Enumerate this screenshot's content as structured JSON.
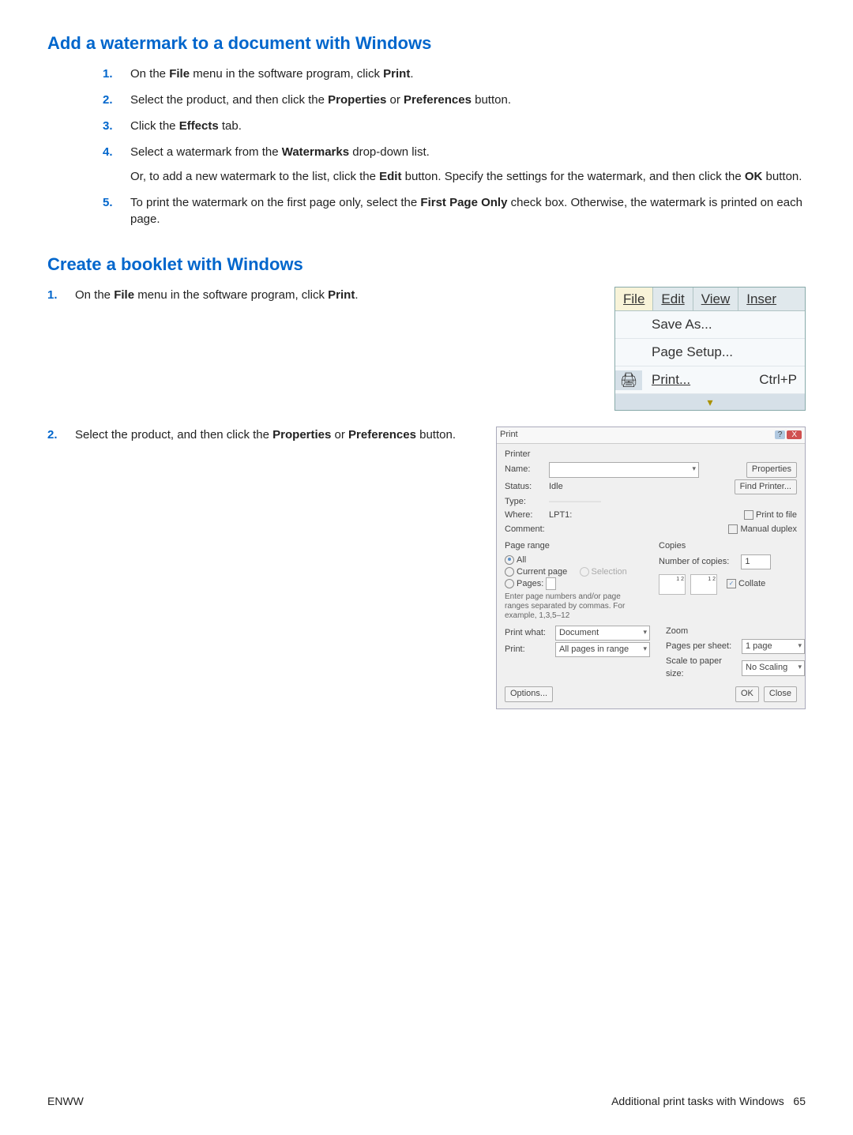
{
  "section1": {
    "title": "Add a watermark to a document with Windows",
    "steps": [
      {
        "n": "1.",
        "pre": "On the ",
        "bold1": "File",
        "mid": " menu in the software program, click ",
        "bold2": "Print",
        "post": "."
      },
      {
        "n": "2.",
        "pre": "Select the product, and then click the ",
        "bold1": "Properties",
        "mid": " or ",
        "bold2": "Preferences",
        "post": " button."
      },
      {
        "n": "3.",
        "pre": "Click the ",
        "bold1": "Effects",
        "post": " tab."
      },
      {
        "n": "4.",
        "pre": "Select a watermark from the ",
        "bold1": "Watermarks",
        "post": " drop-down list.",
        "para2_pre": "Or, to add a new watermark to the list, click the ",
        "para2_b1": "Edit",
        "para2_mid": " button. Specify the settings for the watermark, and then click the ",
        "para2_b2": "OK",
        "para2_post": " button."
      },
      {
        "n": "5.",
        "pre": "To print the watermark on the first page only, select the ",
        "bold1": "First Page Only",
        "post": " check box. Otherwise, the watermark is printed on each page."
      }
    ]
  },
  "section2": {
    "title": "Create a booklet with Windows",
    "step1": {
      "n": "1.",
      "pre": "On the ",
      "bold1": "File",
      "mid": " menu in the software program, click ",
      "bold2": "Print",
      "post": "."
    },
    "step2": {
      "n": "2.",
      "pre": "Select the product, and then click the ",
      "bold1": "Properties",
      "mid": " or ",
      "bold2": "Preferences",
      "post": " button."
    }
  },
  "filemenu": {
    "tabs": {
      "file": "File",
      "edit": "Edit",
      "view": "View",
      "inser": "Inser"
    },
    "items": {
      "saveas": "Save As...",
      "pagesetup": "Page Setup...",
      "print": "Print...",
      "print_shortcut": "Ctrl+P"
    }
  },
  "printdlg": {
    "title": "Print",
    "printer_group": "Printer",
    "name_label": "Name:",
    "status_label": "Status:",
    "status_value": "Idle",
    "type_label": "Type:",
    "where_label": "Where:",
    "where_value": "LPT1:",
    "comment_label": "Comment:",
    "properties_btn": "Properties",
    "find_printer_btn": "Find Printer...",
    "print_to_file": "Print to file",
    "manual_duplex": "Manual duplex",
    "pagerange_group": "Page range",
    "all_opt": "All",
    "current_opt": "Current page",
    "selection_opt": "Selection",
    "pages_opt": "Pages:",
    "pages_hint": "Enter page numbers and/or page ranges separated by commas. For example, 1,3,5–12",
    "copies_group": "Copies",
    "num_copies_label": "Number of copies:",
    "num_copies_value": "1",
    "collate": "Collate",
    "printwhat_label": "Print what:",
    "printwhat_value": "Document",
    "print_label": "Print:",
    "print_value": "All pages in range",
    "zoom_group": "Zoom",
    "pps_label": "Pages per sheet:",
    "pps_value": "1 page",
    "scale_label": "Scale to paper size:",
    "scale_value": "No Scaling",
    "options_btn": "Options...",
    "ok_btn": "OK",
    "close_btn": "Close"
  },
  "footer": {
    "left": "ENWW",
    "right_text": "Additional print tasks with Windows",
    "page": "65"
  }
}
